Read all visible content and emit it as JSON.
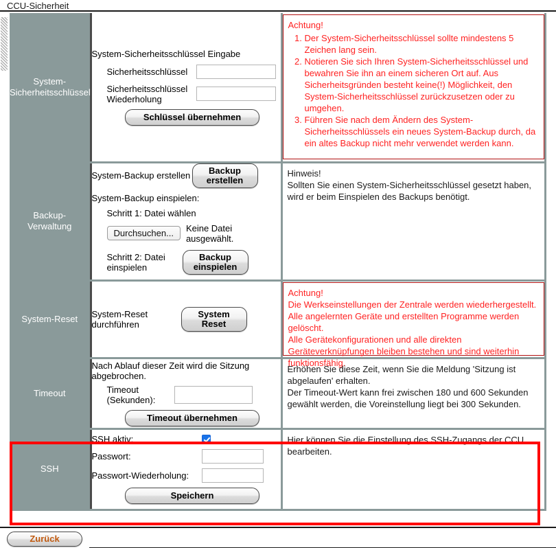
{
  "window": {
    "title": "CCU-Sicherheit"
  },
  "colors": {
    "sidebar_bg": "#8a9a9a",
    "warning_text": "#ff2222",
    "warning_border": "#b01010",
    "highlight_box": "#ff0000",
    "back_button_text": "#c05a10",
    "checkbox_accent": "#1a73e8"
  },
  "sections": {
    "security_key": {
      "label": "System-\nSicherheitsschlüssel",
      "form_title": "System-Sicherheitsschlüssel Eingabe",
      "field1_label": "Sicherheitsschlüssel",
      "field1_value": "",
      "field2_label": "Sicherheitsschlüssel Wiederholung",
      "field2_value": "",
      "submit_label": "Schlüssel übernehmen",
      "info_heading": "Achtung!",
      "info_items": [
        "Der System-Sicherheitsschlüssel sollte mindestens 5 Zeichen lang sein.",
        "Notieren Sie sich Ihren System-Sicherheitsschlüssel und bewahren Sie ihn an einem sicheren Ort auf. Aus Sicherheitsgründen besteht keine(!) Möglichkeit, den System-Sicherheitsschlüssel zurückzusetzen oder zu umgehen.",
        "Führen Sie nach dem Ändern des System-Sicherheitsschlüssels ein neues System-Backup durch, da ein altes Backup nicht mehr verwendet werden kann."
      ]
    },
    "backup": {
      "label": "Backup-\nVerwaltung",
      "create_label": "System-Backup erstellen",
      "create_button": "Backup\nerstellen",
      "restore_label": "System-Backup einspielen:",
      "step1_label": "Schritt 1: Datei wählen",
      "file_button": "Durchsuchen...",
      "file_status": "Keine Datei ausgewählt.",
      "step2_label": "Schritt 2: Datei einspielen",
      "restore_button": "Backup\neinspielen",
      "info_heading": "Hinweis!",
      "info_text": "Sollten Sie einen System-Sicherheitsschlüssel gesetzt haben, wird er beim Einspielen des Backups benötigt."
    },
    "system_reset": {
      "label": "System-Reset",
      "action_label": "System-Reset durchführen",
      "button": "System\nReset",
      "info_heading": "Achtung!",
      "info_lines": [
        "Die Werkseinstellungen der Zentrale werden wiederhergestellt. Alle angelernten Geräte und erstellten Programme werden gelöscht.",
        "Alle Gerätekonfigurationen und alle direkten Geräteverknüpfungen bleiben bestehen und sind weiterhin funktionsfähig."
      ]
    },
    "timeout": {
      "label": "Timeout",
      "description": "Nach Ablauf dieser Zeit wird die Sitzung abgebrochen.",
      "field_label": "Timeout (Sekunden):",
      "field_value": "",
      "submit_label": "Timeout übernehmen",
      "info_lines": [
        "Erhöhen Sie diese Zeit, wenn Sie die Meldung 'Sitzung ist abgelaufen' erhalten.",
        "Der Timeout-Wert kann frei zwischen 180 und 600 Sekunden gewählt werden, die Voreinstellung liegt bei 300 Sekunden."
      ]
    },
    "ssh": {
      "label": "SSH",
      "active_label": "SSH aktiv:",
      "active_checked": true,
      "password_label": "Passwort:",
      "password_value": "",
      "password_repeat_label": "Passwort-Wiederholung:",
      "password_repeat_value": "",
      "submit_label": "Speichern",
      "info_text": "Hier können Sie die Einstellung des SSH-Zugangs der CCU bearbeiten."
    }
  },
  "footer": {
    "back_label": "Zurück"
  }
}
